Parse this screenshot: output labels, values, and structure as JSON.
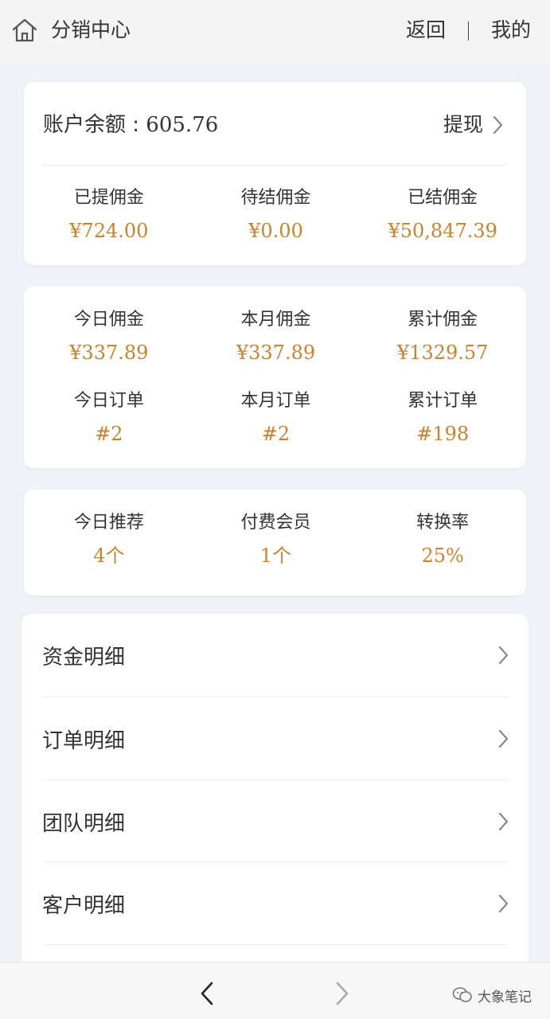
{
  "header": {
    "title": "分销中心",
    "back_label": "返回",
    "mine_label": "我的"
  },
  "balance": {
    "label": "账户余额 : ",
    "value": "605.76",
    "withdraw_label": "提现",
    "stats": [
      {
        "label": "已提佣金",
        "value": "¥724.00"
      },
      {
        "label": "待结佣金",
        "value": "¥0.00"
      },
      {
        "label": "已结佣金",
        "value": "¥50,847.39"
      }
    ]
  },
  "commission": {
    "row1": [
      {
        "label": "今日佣金",
        "value": "¥337.89"
      },
      {
        "label": "本月佣金",
        "value": "¥337.89"
      },
      {
        "label": "累计佣金",
        "value": "¥1329.57"
      }
    ],
    "row2": [
      {
        "label": "今日订单",
        "value": "#2"
      },
      {
        "label": "本月订单",
        "value": "#2"
      },
      {
        "label": "累计订单",
        "value": "#198"
      }
    ]
  },
  "members": [
    {
      "label": "今日推荐",
      "value": "4个"
    },
    {
      "label": "付费会员",
      "value": "1个"
    },
    {
      "label": "转换率",
      "value": "25%"
    }
  ],
  "menu": [
    {
      "label": "资金明细"
    },
    {
      "label": "订单明细"
    },
    {
      "label": "团队明细"
    },
    {
      "label": "客户明细"
    }
  ],
  "watermark": {
    "text": "大象笔记",
    "icon": "wechat-icon"
  },
  "colors": {
    "accent": "#c9832f",
    "background": "#eff2f7"
  },
  "icons": {
    "home": "home-icon",
    "chevron": "chevron-right-icon",
    "nav_back": "arrow-left-icon",
    "nav_forward": "arrow-right-icon"
  }
}
